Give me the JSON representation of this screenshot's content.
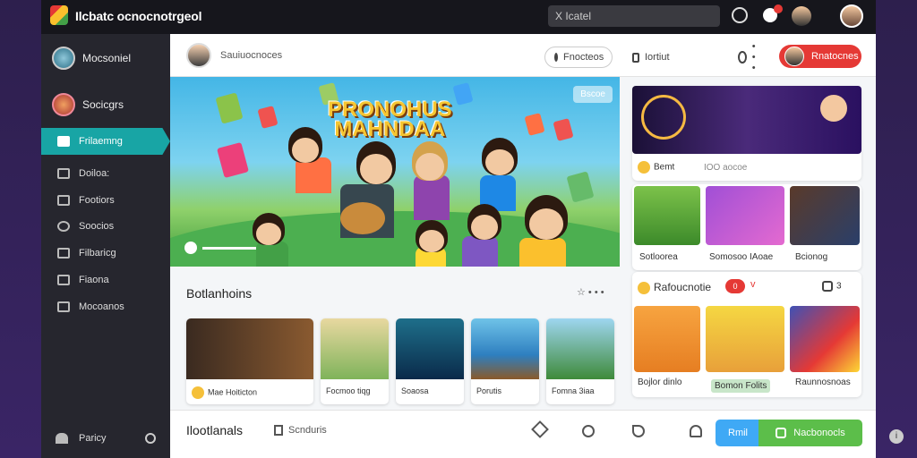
{
  "topbar": {
    "title": "Ilcbatc ocnocnotrgeol",
    "search": "X Icatel"
  },
  "sidebar": {
    "user": "Mocsoniel",
    "secondary": "Socicgrs",
    "items": [
      {
        "label": "Frilaemng",
        "active": true
      },
      {
        "label": "Doiloa:"
      },
      {
        "label": "Footiors"
      },
      {
        "label": "Soocios"
      },
      {
        "label": "Filbaricg"
      },
      {
        "label": "Fiaona"
      },
      {
        "label": "Mocoanos"
      }
    ],
    "footer": "Paricy"
  },
  "header": {
    "username": "Sauiuocnoces",
    "search_btn": "Fnocteos",
    "second_btn": "Iortiut",
    "menu_dots": "• • •",
    "red_btn": "Rnatocnes"
  },
  "hero": {
    "title_line1": "PRONOHUS",
    "title_line2": "MAHNDAA",
    "chip": "Bscoe"
  },
  "right": {
    "feature_label": "Bemt",
    "feature_meta": "IOO aocoe",
    "row_labels": [
      "Sotloorea",
      "Somosoo IAoae",
      "Bcionog"
    ],
    "group_title": "Rafoucnotie",
    "group_badge": "0",
    "group_count": "3",
    "group_labels": [
      "Bojlor dinlo",
      "Bomon Folits",
      "Raunnosnoas"
    ]
  },
  "section": {
    "title": "Botlanhoins",
    "items": [
      "Mae Hoiticton",
      "Focmoo tiqg",
      "Soaosa",
      "Porutis",
      "Fomna 3iaa"
    ]
  },
  "bottom": {
    "title": "Ilootlanals",
    "sub": "Scnduris",
    "blue_btn": "Rmil",
    "green_btn": "Nacbonocls"
  }
}
